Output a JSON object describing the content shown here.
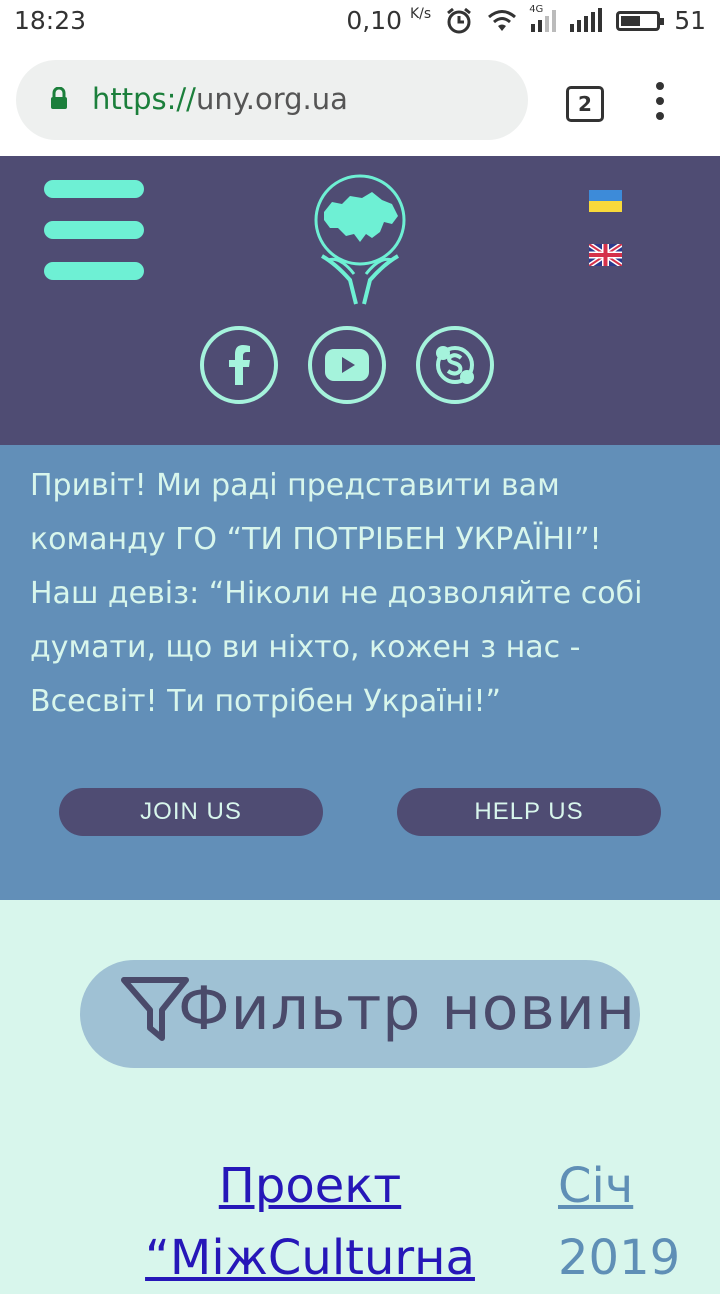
{
  "status_bar": {
    "time": "18:23",
    "net_speed": "0,10",
    "net_unit": "K/s",
    "net_type": "4G",
    "battery": "51"
  },
  "browser": {
    "url_scheme": "https://",
    "url_host": "uny.org.ua",
    "tab_count": "2"
  },
  "header": {
    "social": [
      "facebook-icon",
      "youtube-icon",
      "skype-icon"
    ],
    "colors": {
      "bg": "#4f4c73",
      "accent": "#6ef0d4"
    }
  },
  "intro": {
    "line1": "Привіт! Ми раді представити вам команду ГО “ТИ ПОТРІБЕН УКРАЇНІ”!",
    "line2": "Наш девіз: “Ніколи не дозволяйте собі думати, що ви ніхто, кожен з нас - Всесвіт! Ти потрібен Україні!”",
    "join_label": "JOIN US",
    "help_label": "HELP US"
  },
  "filter": {
    "label": "Фильтр новин"
  },
  "news": {
    "title": "Проект “МіжCulturна",
    "date_month": "Січ",
    "date_year": "2019"
  }
}
